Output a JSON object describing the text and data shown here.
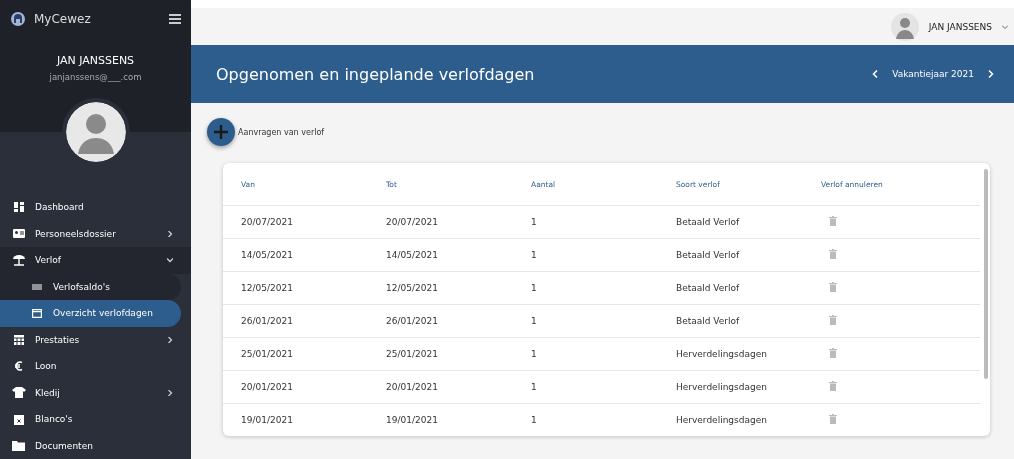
{
  "brand": "MyCewez",
  "profile": {
    "name": "JAN JANSSENS",
    "email": "janjanssens@___.com"
  },
  "sidebar": {
    "items": [
      {
        "label": "Dashboard",
        "kind": "grid",
        "has_submenu": false,
        "expanded": false,
        "selected": false
      },
      {
        "label": "Personeelsdossier",
        "kind": "card",
        "has_submenu": true,
        "expanded": false,
        "selected": false
      },
      {
        "label": "Verlof",
        "kind": "umbrella",
        "has_submenu": true,
        "expanded": true,
        "selected": false,
        "children": [
          {
            "label": "Verlofsaldo's",
            "kind": "list",
            "selected": false
          },
          {
            "label": "Overzicht verlofdagen",
            "kind": "calendar",
            "selected": true
          }
        ]
      },
      {
        "label": "Prestaties",
        "kind": "calendar-grid",
        "has_submenu": true,
        "expanded": false,
        "selected": false
      },
      {
        "label": "Loon",
        "kind": "euro",
        "has_submenu": false,
        "expanded": false,
        "selected": false
      },
      {
        "label": "Kledij",
        "kind": "shirt",
        "has_submenu": true,
        "expanded": false,
        "selected": false
      },
      {
        "label": "Blanco's",
        "kind": "calendar-x",
        "has_submenu": false,
        "expanded": false,
        "selected": false
      },
      {
        "label": "Documenten",
        "kind": "folder",
        "has_submenu": false,
        "expanded": false,
        "selected": false
      }
    ]
  },
  "topbar": {
    "user": "JAN JANSSENS"
  },
  "header": {
    "title": "Opgenomen en ingeplande verlofdagen",
    "period": "Vakantiejaar 2021"
  },
  "add_action": {
    "label": "Aanvragen van verlof"
  },
  "table": {
    "columns": [
      "Van",
      "Tot",
      "Aantal",
      "Soort verlof",
      "Verlof annuleren"
    ],
    "rows": [
      [
        "20/07/2021",
        "20/07/2021",
        "1",
        "Betaald Verlof"
      ],
      [
        "14/05/2021",
        "14/05/2021",
        "1",
        "Betaald Verlof"
      ],
      [
        "12/05/2021",
        "12/05/2021",
        "1",
        "Betaald Verlof"
      ],
      [
        "26/01/2021",
        "26/01/2021",
        "1",
        "Betaald Verlof"
      ],
      [
        "25/01/2021",
        "25/01/2021",
        "1",
        "Herverdelingsdagen"
      ],
      [
        "20/01/2021",
        "20/01/2021",
        "1",
        "Herverdelingsdagen"
      ],
      [
        "19/01/2021",
        "19/01/2021",
        "1",
        "Herverdelingsdagen"
      ]
    ]
  }
}
